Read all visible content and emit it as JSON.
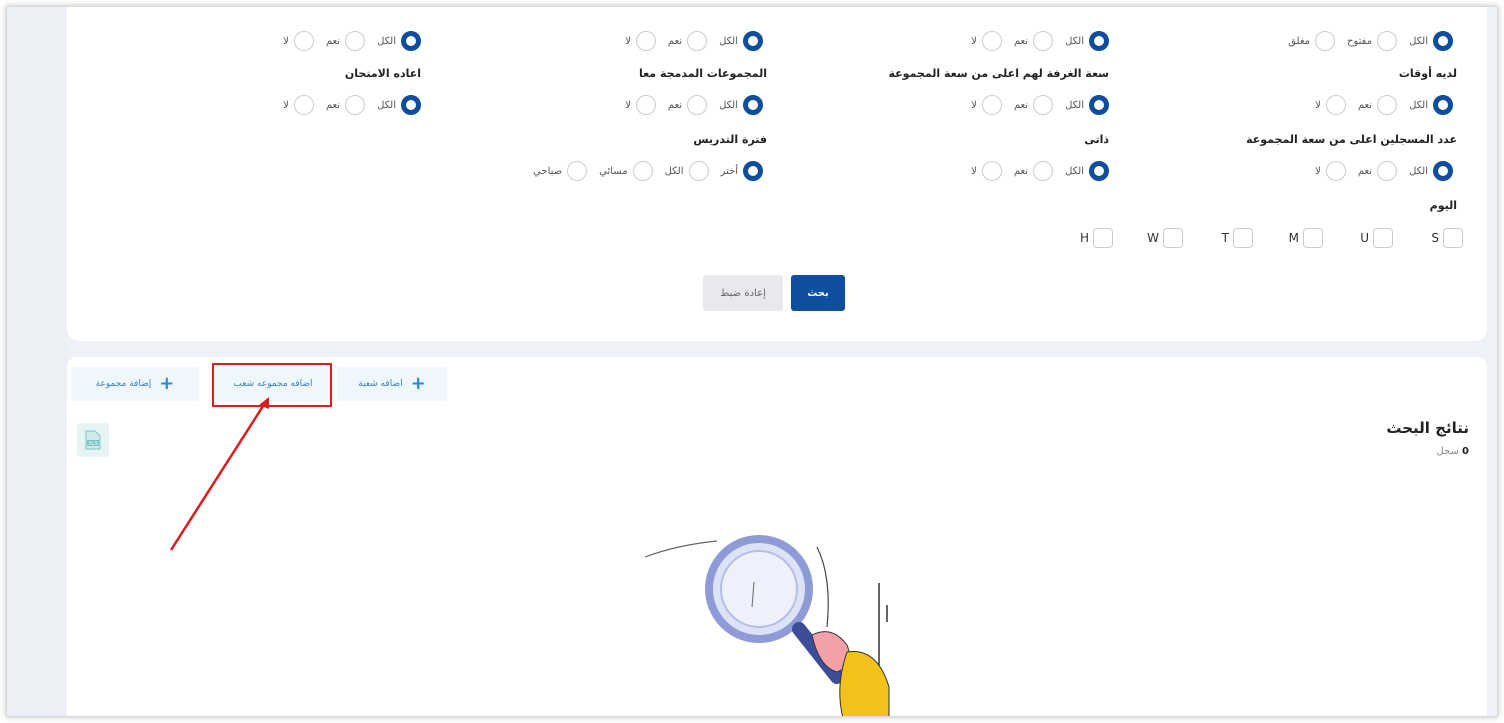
{
  "filters": {
    "row1": [
      {
        "options": [
          "الكل",
          "مفتوح",
          "مغلق"
        ]
      },
      {
        "options": [
          "الكل",
          "نعم",
          "لا"
        ]
      },
      {
        "options": [
          "الكل",
          "نعم",
          "لا"
        ]
      },
      {
        "options": [
          "الكل",
          "نعم",
          "لا"
        ]
      }
    ],
    "row2_labels": [
      "لديه أوقات",
      "سعة الغرفة لهم اعلى من سعة المجموعة",
      "المجموعات المدمجة معا",
      "اعاده الامتحان"
    ],
    "row2": [
      {
        "options": [
          "الكل",
          "نعم",
          "لا"
        ]
      },
      {
        "options": [
          "الكل",
          "نعم",
          "لا"
        ]
      },
      {
        "options": [
          "الكل",
          "نعم",
          "لا"
        ]
      },
      {
        "options": [
          "الكل",
          "نعم",
          "لا"
        ]
      }
    ],
    "row3_labels": [
      "عدد المسجلين اعلى من سعة المجموعة",
      "ذاتى",
      "فترة التدريس"
    ],
    "row3": [
      {
        "options": [
          "الكل",
          "نعم",
          "لا"
        ]
      },
      {
        "options": [
          "الكل",
          "نعم",
          "لا"
        ]
      },
      {
        "options": [
          "أختر",
          "الكل",
          "مسائي",
          "صباحي"
        ]
      }
    ],
    "day_label": "اليوم",
    "days": [
      "S",
      "U",
      "M",
      "T",
      "W",
      "H"
    ]
  },
  "actions": {
    "search_label": "بحث",
    "reset_label": "إعادة ضبط"
  },
  "toolbar": {
    "add_group_label": "إضافة مجموعة",
    "add_group_sections_label": "اضافه مجموعه شعب",
    "add_section_label": "اضافه شعبة"
  },
  "results": {
    "title": "نتائج البحث",
    "count": "0",
    "count_unit": "سجل"
  },
  "colors": {
    "primary": "#0d4f9e",
    "highlight": "#e11b1b",
    "accent_plus": "#1e88e5"
  },
  "icons": {
    "xls": "xls-file-icon",
    "empty_state": "magnifying-glass-illustration",
    "plus": "plus-icon"
  }
}
